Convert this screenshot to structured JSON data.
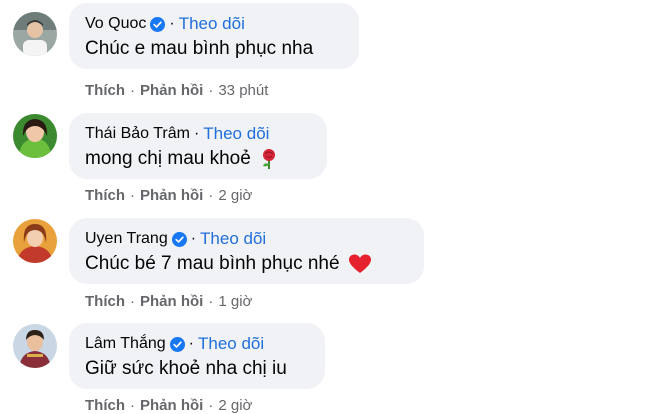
{
  "comments": [
    {
      "author": "Vo Quoc",
      "verified": true,
      "follow": "Theo dõi",
      "text": "Chúc e mau bình phục nha",
      "emoji": "",
      "like": "Thích",
      "reply": "Phản hồi",
      "time": "33 phút"
    },
    {
      "author": "Thái Bảo Trâm",
      "verified": false,
      "follow": "Theo dõi",
      "text": "mong chị mau khoẻ",
      "emoji": "rose-emoji",
      "like": "Thích",
      "reply": "Phản hồi",
      "time": "2 giờ"
    },
    {
      "author": "Uyen Trang",
      "verified": true,
      "follow": "Theo dõi",
      "text": "Chúc bé 7 mau bình phục nhé",
      "emoji": "red-heart-emoji",
      "like": "Thích",
      "reply": "Phản hồi",
      "time": "1 giờ"
    },
    {
      "author": "Lâm Thắng",
      "verified": true,
      "follow": "Theo dõi",
      "text": "Giữ sức khoẻ nha chị iu",
      "emoji": "",
      "like": "Thích",
      "reply": "Phản hồi",
      "time": "2 giờ"
    }
  ],
  "separator": "·",
  "colors": {
    "bubble": "#f0f2f5",
    "follow_link": "#216fdb",
    "meta": "#65676b",
    "verified": "#1877f2"
  }
}
